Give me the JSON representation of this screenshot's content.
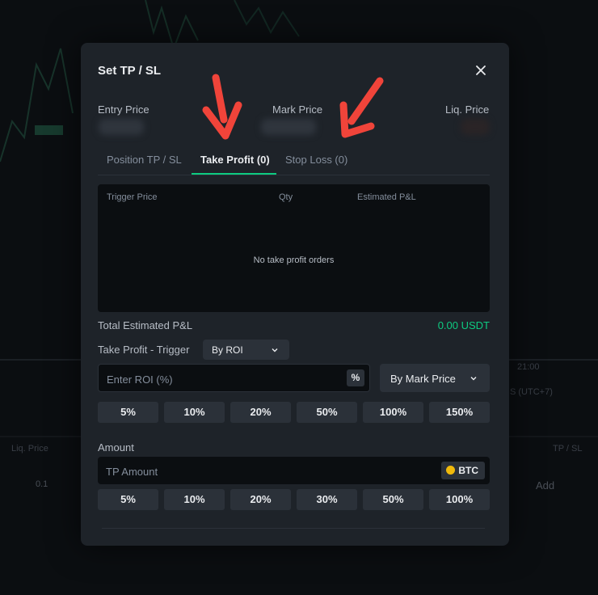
{
  "background": {
    "labels": [
      "Liq. Price",
      "0.1",
      "TP / SL",
      "Add",
      "21:00",
      "S (UTC+7)"
    ]
  },
  "modal": {
    "title": "Set TP / SL",
    "prices": {
      "entry_label": "Entry Price",
      "mark_label": "Mark Price",
      "liq_label": "Liq. Price"
    },
    "tabs": [
      {
        "label": "Position TP / SL"
      },
      {
        "label": "Take Profit (0)"
      },
      {
        "label": "Stop Loss (0)"
      }
    ],
    "table": {
      "headers": [
        "Trigger Price",
        "Qty",
        "Estimated P&L"
      ],
      "empty_message": "No take profit orders"
    },
    "total_pnl": {
      "label": "Total Estimated P&L",
      "value": "0.00 USDT"
    },
    "trigger": {
      "label": "Take Profit - Trigger",
      "mode": "By ROI",
      "roi_placeholder": "Enter ROI (%)",
      "unit": "%",
      "price_type": "By Mark Price",
      "presets": [
        "5%",
        "10%",
        "20%",
        "50%",
        "100%",
        "150%"
      ]
    },
    "amount": {
      "label": "Amount",
      "placeholder": "TP Amount",
      "coin": "BTC",
      "presets": [
        "5%",
        "10%",
        "20%",
        "30%",
        "50%",
        "100%"
      ]
    }
  },
  "colors": {
    "accent_green": "#0ecb81",
    "annotation_red": "#f0443a",
    "coin_yellow": "#f0b90b"
  }
}
